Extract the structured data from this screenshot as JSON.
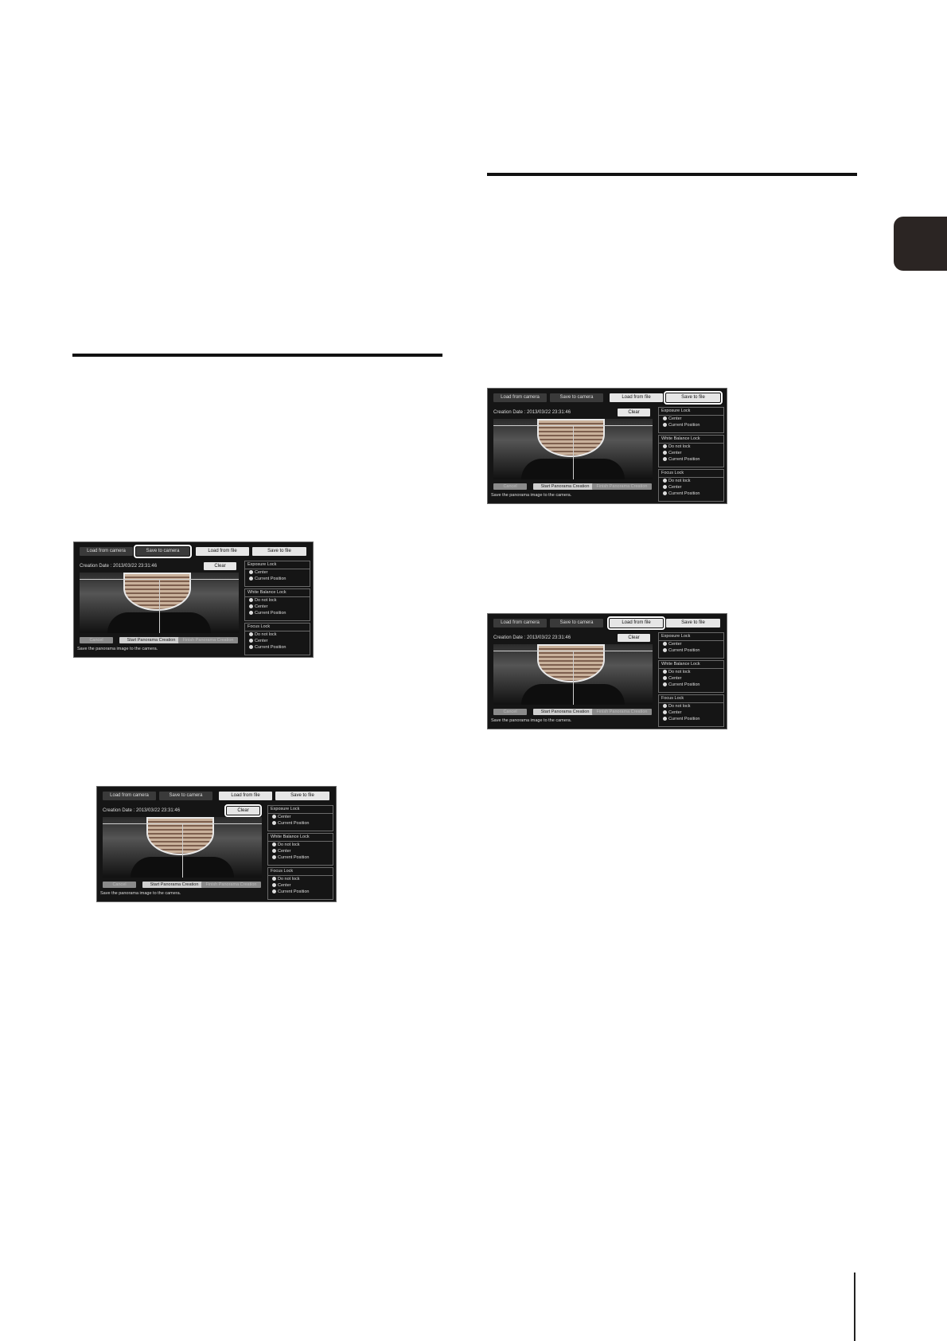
{
  "panels": [
    {
      "highlight": "save-to-camera",
      "buttons": [
        "Load from camera",
        "Save to camera",
        "Load from file",
        "Save to file"
      ],
      "creation_date": "Creation Date : 2013/03/22 23:31:46",
      "clear": "Clear",
      "bottom_buttons": [
        "Cancel",
        "Start Panorama Creation",
        "Finish Panorama Creation"
      ],
      "message": "Save the panorama image to the camera.",
      "groups": [
        {
          "title": "Exposure Lock",
          "options": [
            "Center",
            "Current Position"
          ]
        },
        {
          "title": "White Balance Lock",
          "options": [
            "Do not lock",
            "Center",
            "Current Position"
          ]
        },
        {
          "title": "Focus Lock",
          "options": [
            "Do not lock",
            "Center",
            "Current Position"
          ]
        }
      ]
    },
    {
      "highlight": "clear",
      "buttons": [
        "Load from camera",
        "Save to camera",
        "Load from file",
        "Save to file"
      ],
      "creation_date": "Creation Date : 2013/03/22 23:31:46",
      "clear": "Clear",
      "bottom_buttons": [
        "Cancel",
        "Start Panorama Creation",
        "Finish Panorama Creation"
      ],
      "message": "Save the panorama image to the camera.",
      "groups": [
        {
          "title": "Exposure Lock",
          "options": [
            "Center",
            "Current Position"
          ]
        },
        {
          "title": "White Balance Lock",
          "options": [
            "Do not lock",
            "Center",
            "Current Position"
          ]
        },
        {
          "title": "Focus Lock",
          "options": [
            "Do not lock",
            "Center",
            "Current Position"
          ]
        }
      ]
    },
    {
      "highlight": "save-to-file",
      "buttons": [
        "Load from camera",
        "Save to camera",
        "Load from file",
        "Save to file"
      ],
      "creation_date": "Creation Date : 2013/03/22 23:31:46",
      "clear": "Clear",
      "bottom_buttons": [
        "Cancel",
        "Start Panorama Creation",
        "Finish Panorama Creation"
      ],
      "message": "Save the panorama image to the camera.",
      "groups": [
        {
          "title": "Exposure Lock",
          "options": [
            "Center",
            "Current Position"
          ]
        },
        {
          "title": "White Balance Lock",
          "options": [
            "Do not lock",
            "Center",
            "Current Position"
          ]
        },
        {
          "title": "Focus Lock",
          "options": [
            "Do not lock",
            "Center",
            "Current Position"
          ]
        }
      ]
    },
    {
      "highlight": "load-from-file",
      "buttons": [
        "Load from camera",
        "Save to camera",
        "Load from file",
        "Save to file"
      ],
      "creation_date": "Creation Date : 2013/03/22 23:31:46",
      "clear": "Clear",
      "bottom_buttons": [
        "Cancel",
        "Start Panorama Creation",
        "Finish Panorama Creation"
      ],
      "message": "Save the panorama image to the camera.",
      "groups": [
        {
          "title": "Exposure Lock",
          "options": [
            "Center",
            "Current Position"
          ]
        },
        {
          "title": "White Balance Lock",
          "options": [
            "Do not lock",
            "Center",
            "Current Position"
          ]
        },
        {
          "title": "Focus Lock",
          "options": [
            "Do not lock",
            "Center",
            "Current Position"
          ]
        }
      ]
    }
  ]
}
